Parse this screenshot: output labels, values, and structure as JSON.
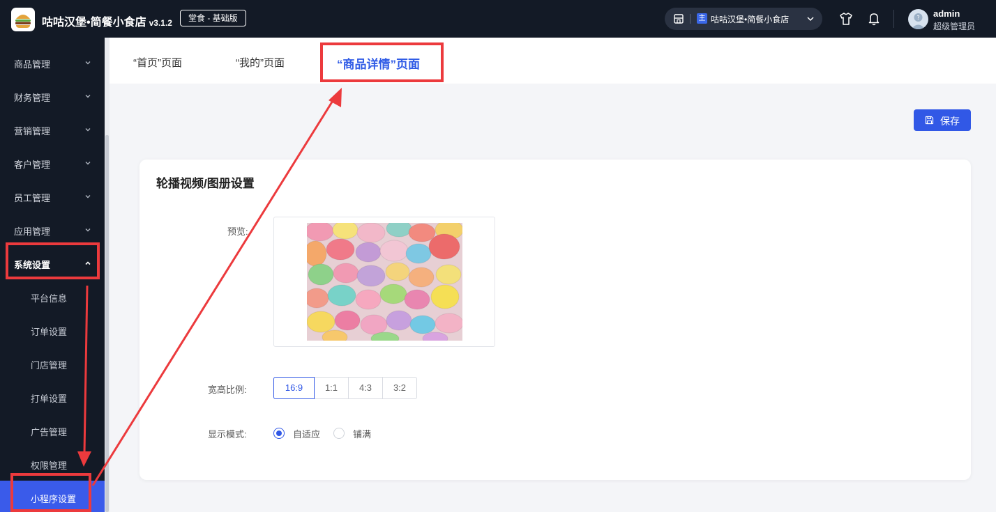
{
  "header": {
    "app_title": "咕咕汉堡•简餐小食店",
    "version": "v3.1.2",
    "edition": "堂食 - 基础版",
    "store_tag": "主",
    "store_name": "咕咕汉堡•简餐小食店",
    "user_name": "admin",
    "user_role": "超级管理员"
  },
  "sidebar": {
    "menus": [
      {
        "label": "商品管理"
      },
      {
        "label": "财务管理"
      },
      {
        "label": "营销管理"
      },
      {
        "label": "客户管理"
      },
      {
        "label": "员工管理"
      },
      {
        "label": "应用管理"
      },
      {
        "label": "系统设置"
      }
    ],
    "submenu": [
      {
        "label": "平台信息"
      },
      {
        "label": "订单设置"
      },
      {
        "label": "门店管理"
      },
      {
        "label": "打单设置"
      },
      {
        "label": "广告管理"
      },
      {
        "label": "权限管理"
      },
      {
        "label": "小程序设置"
      }
    ]
  },
  "tabs": [
    {
      "label": "“首页”页面"
    },
    {
      "label": "“我的”页面"
    },
    {
      "label": "“商品详情”页面"
    }
  ],
  "toolbar": {
    "save_label": "保存"
  },
  "card": {
    "title": "轮播视频/图册设置",
    "preview_label": "预览:",
    "ratio_label": "宽高比例:",
    "ratios": [
      "16:9",
      "1:1",
      "4:3",
      "3:2"
    ],
    "selected_ratio": "16:9",
    "mode_label": "显示模式:",
    "modes": [
      "自适应",
      "铺满"
    ],
    "selected_mode": "自适应"
  },
  "colors": {
    "accent": "#3158e6",
    "sidebar_bg": "#131a26",
    "annotation": "#ec3a3d"
  }
}
